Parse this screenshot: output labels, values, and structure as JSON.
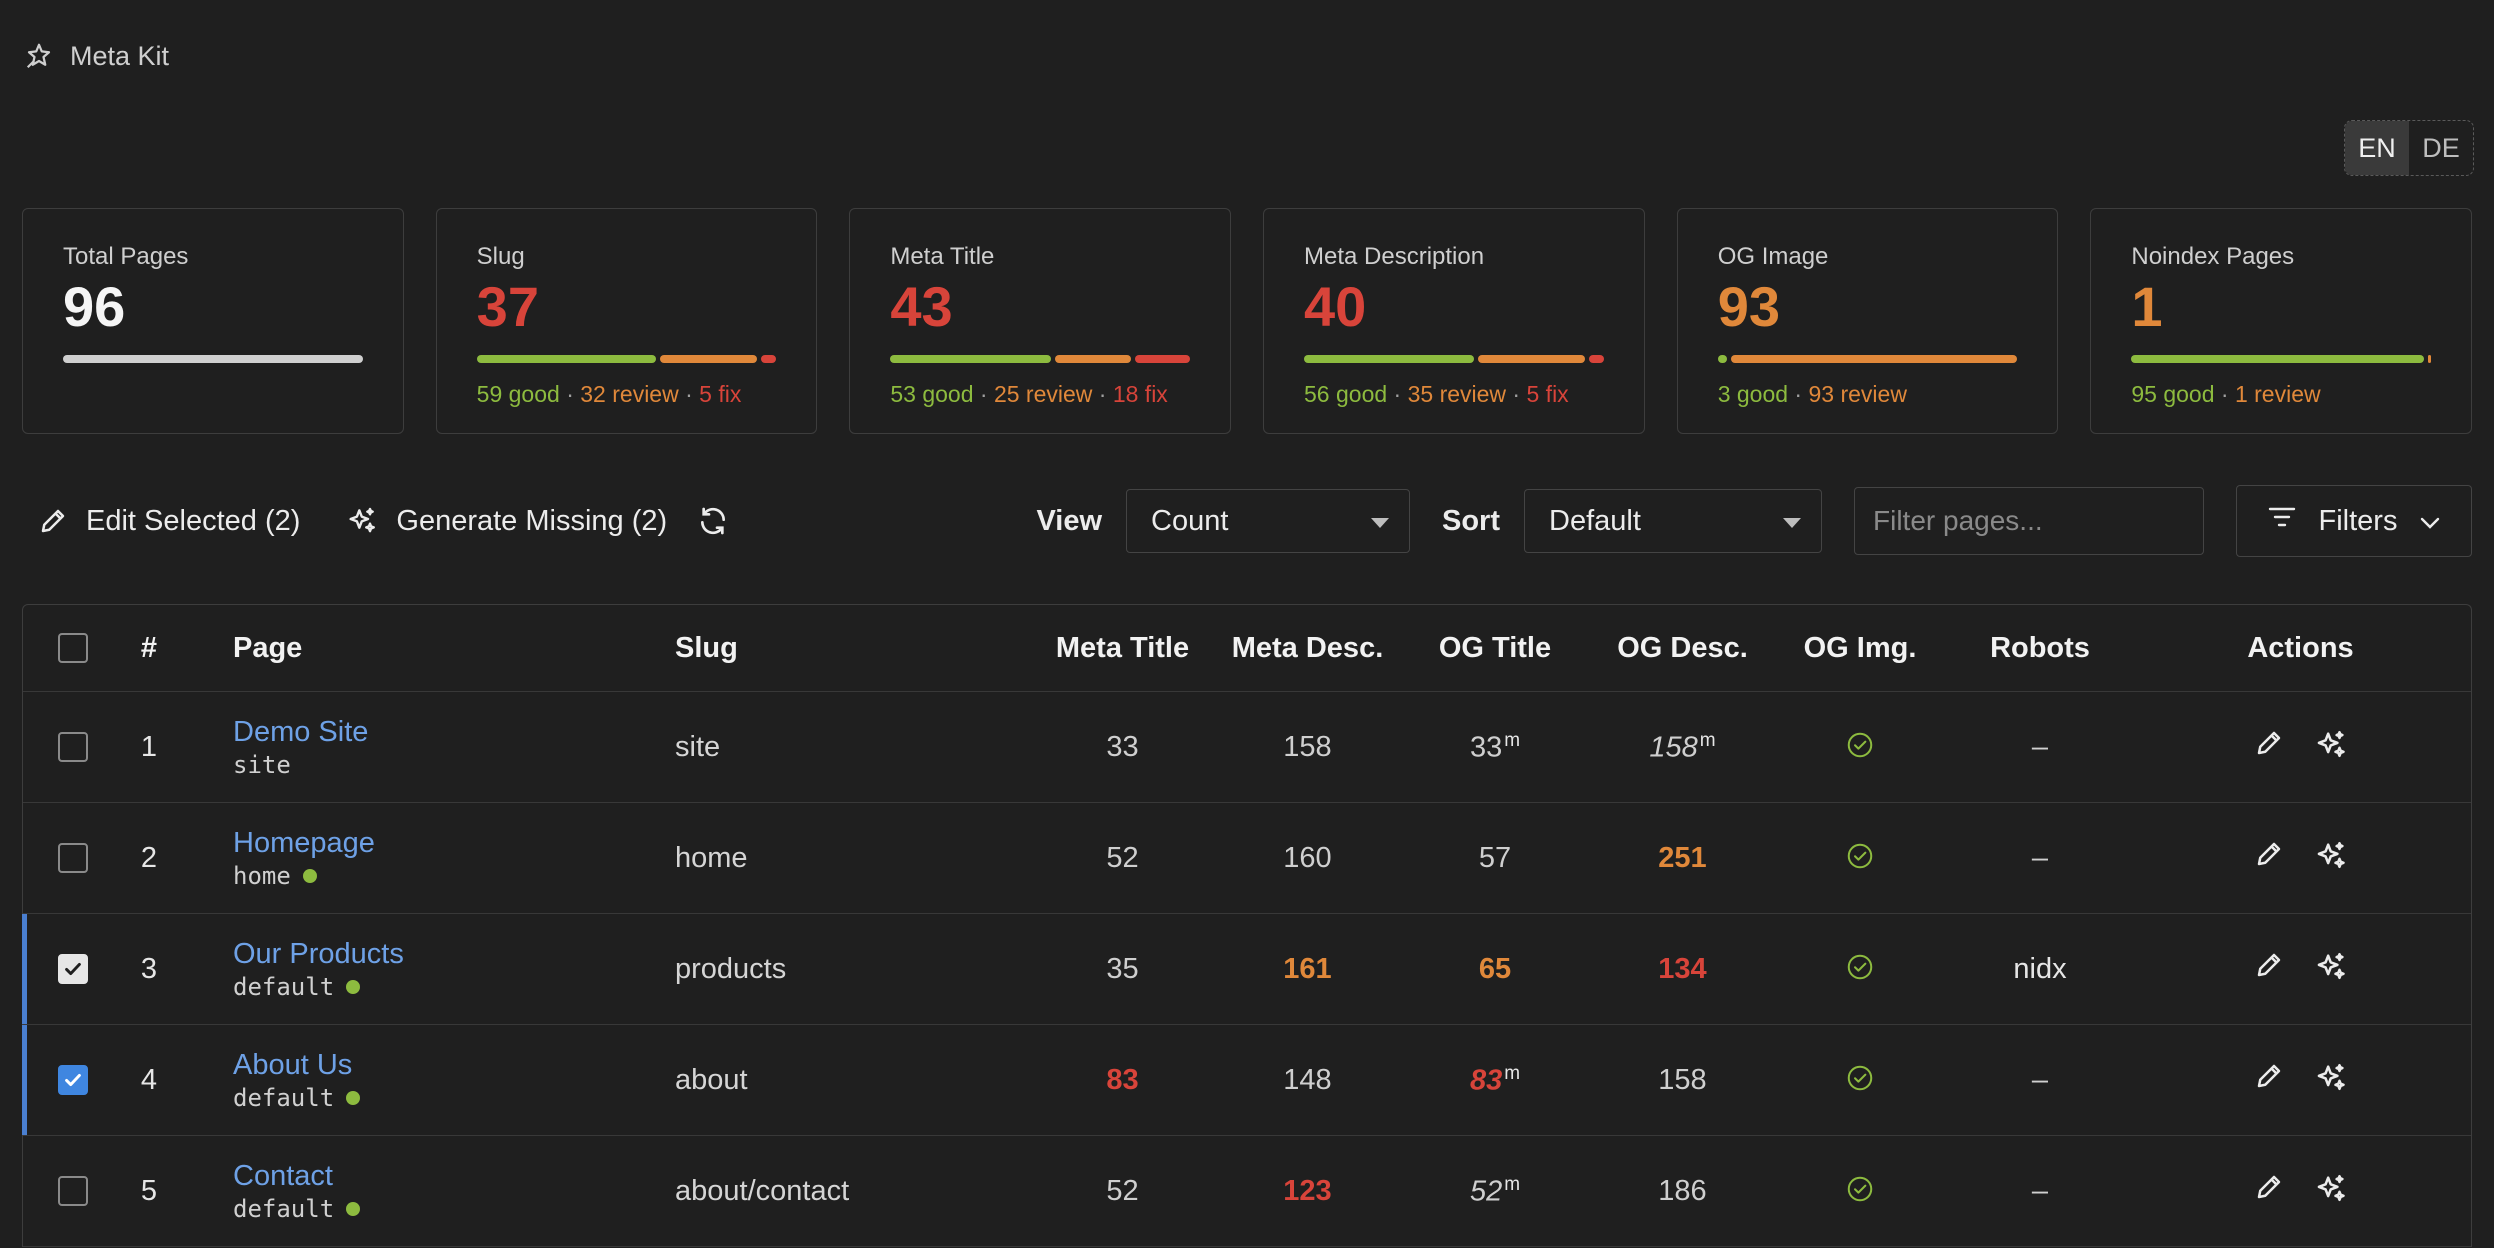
{
  "app": {
    "title": "Meta Kit"
  },
  "lang": {
    "en": "EN",
    "de": "DE"
  },
  "colors": {
    "good": "#8dbb3f",
    "review": "#e0883a",
    "fix": "#d8443a",
    "link": "#6ea1e6",
    "accent": "#3f86e0"
  },
  "stats": [
    {
      "label": "Total Pages",
      "value": "96",
      "value_color": "#f5f5f5",
      "bar": [
        {
          "pct": 100,
          "color": "#cfcfcf"
        }
      ],
      "legend": []
    },
    {
      "label": "Slug",
      "value": "37",
      "value_color": "#d8443a",
      "bar": [
        {
          "pct": 61.5,
          "color": "#8dbb3f"
        },
        {
          "pct": 33.3,
          "color": "#e0883a"
        },
        {
          "pct": 5.2,
          "color": "#d8443a"
        }
      ],
      "legend": [
        {
          "text": "59 good",
          "cls": "green"
        },
        {
          "text": "32 review",
          "cls": "orange"
        },
        {
          "text": "5 fix",
          "cls": "red"
        }
      ]
    },
    {
      "label": "Meta Title",
      "value": "43",
      "value_color": "#d8443a",
      "bar": [
        {
          "pct": 55.2,
          "color": "#8dbb3f"
        },
        {
          "pct": 26.0,
          "color": "#e0883a"
        },
        {
          "pct": 18.8,
          "color": "#d8443a"
        }
      ],
      "legend": [
        {
          "text": "53 good",
          "cls": "green"
        },
        {
          "text": "25 review",
          "cls": "orange"
        },
        {
          "text": "18 fix",
          "cls": "red"
        }
      ]
    },
    {
      "label": "Meta Description",
      "value": "40",
      "value_color": "#d8443a",
      "bar": [
        {
          "pct": 58.3,
          "color": "#8dbb3f"
        },
        {
          "pct": 36.5,
          "color": "#e0883a"
        },
        {
          "pct": 5.2,
          "color": "#d8443a"
        }
      ],
      "legend": [
        {
          "text": "56 good",
          "cls": "green"
        },
        {
          "text": "35 review",
          "cls": "orange"
        },
        {
          "text": "5 fix",
          "cls": "red"
        }
      ]
    },
    {
      "label": "OG Image",
      "value": "93",
      "value_color": "#e0883a",
      "bar": [
        {
          "pct": 3.1,
          "color": "#8dbb3f"
        },
        {
          "pct": 96.9,
          "color": "#e0883a"
        }
      ],
      "legend": [
        {
          "text": "3 good",
          "cls": "green"
        },
        {
          "text": "93 review",
          "cls": "orange"
        }
      ]
    },
    {
      "label": "Noindex Pages",
      "value": "1",
      "value_color": "#e0883a",
      "bar": [
        {
          "pct": 99,
          "color": "#8dbb3f"
        },
        {
          "pct": 1,
          "color": "#e0883a"
        }
      ],
      "legend": [
        {
          "text": "95 good",
          "cls": "green"
        },
        {
          "text": "1 review",
          "cls": "orange"
        }
      ]
    }
  ],
  "toolbar": {
    "edit_label": "Edit Selected (2)",
    "generate_label": "Generate Missing (2)",
    "view_label": "View",
    "view_value": "Count",
    "sort_label": "Sort",
    "sort_value": "Default",
    "filter_placeholder": "Filter pages...",
    "filters_label": "Filters"
  },
  "table": {
    "headers": {
      "num": "#",
      "page": "Page",
      "slug": "Slug",
      "meta_title": "Meta Title",
      "meta_desc": "Meta Desc.",
      "og_title": "OG Title",
      "og_desc": "OG Desc.",
      "og_img": "OG Img.",
      "robots": "Robots",
      "actions": "Actions"
    },
    "rows": [
      {
        "num": "1",
        "name": "Demo Site",
        "template": "site",
        "dot": false,
        "slug": "site",
        "selected": false,
        "check": "off",
        "meta_title": {
          "v": "33",
          "cls": ""
        },
        "meta_desc": {
          "v": "158",
          "cls": ""
        },
        "og_title": {
          "v": "33",
          "cls": "",
          "sup": "m"
        },
        "og_desc": {
          "v": "158",
          "cls": "italic",
          "sup": "m"
        },
        "og_img": "check",
        "robots": "–"
      },
      {
        "num": "2",
        "name": "Homepage",
        "template": "home",
        "dot": true,
        "slug": "home",
        "selected": false,
        "check": "off",
        "meta_title": {
          "v": "52",
          "cls": ""
        },
        "meta_desc": {
          "v": "160",
          "cls": ""
        },
        "og_title": {
          "v": "57",
          "cls": ""
        },
        "og_desc": {
          "v": "251",
          "cls": "orange"
        },
        "og_img": "check",
        "robots": "–"
      },
      {
        "num": "3",
        "name": "Our Products",
        "template": "default",
        "dot": true,
        "slug": "products",
        "selected": true,
        "check": "white",
        "meta_title": {
          "v": "35",
          "cls": ""
        },
        "meta_desc": {
          "v": "161",
          "cls": "orange"
        },
        "og_title": {
          "v": "65",
          "cls": "orange"
        },
        "og_desc": {
          "v": "134",
          "cls": "red"
        },
        "og_img": "check",
        "robots": "nidx"
      },
      {
        "num": "4",
        "name": "About Us",
        "template": "default",
        "dot": true,
        "slug": "about",
        "selected": true,
        "check": "blue",
        "meta_title": {
          "v": "83",
          "cls": "red"
        },
        "meta_desc": {
          "v": "148",
          "cls": ""
        },
        "og_title": {
          "v": "83",
          "cls": "red italic",
          "sup": "m"
        },
        "og_desc": {
          "v": "158",
          "cls": ""
        },
        "og_img": "check",
        "robots": "–"
      },
      {
        "num": "5",
        "name": "Contact",
        "template": "default",
        "dot": true,
        "slug": "about/contact",
        "selected": false,
        "check": "off",
        "meta_title": {
          "v": "52",
          "cls": ""
        },
        "meta_desc": {
          "v": "123",
          "cls": "red"
        },
        "og_title": {
          "v": "52",
          "cls": "italic",
          "sup": "m"
        },
        "og_desc": {
          "v": "186",
          "cls": ""
        },
        "og_img": "check",
        "robots": "–"
      }
    ]
  }
}
